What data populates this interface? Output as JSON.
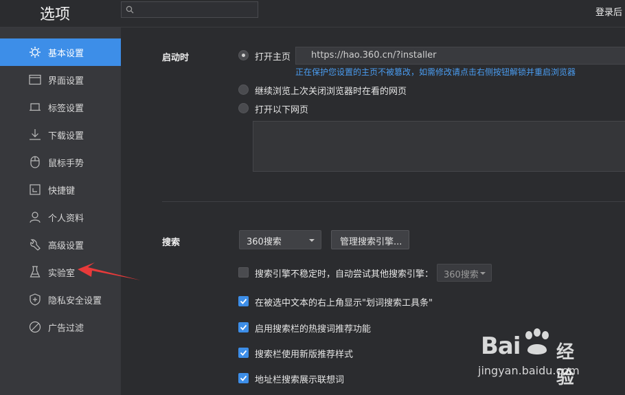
{
  "header": {
    "title": "选项",
    "search": {
      "value": "",
      "placeholder": ""
    },
    "login_label": "登录后"
  },
  "sidebar": {
    "items": [
      {
        "label": "基本设置",
        "icon": "gear-icon",
        "active": true
      },
      {
        "label": "界面设置",
        "icon": "window-icon",
        "active": false
      },
      {
        "label": "标签设置",
        "icon": "tab-icon",
        "active": false
      },
      {
        "label": "下载设置",
        "icon": "download-icon",
        "active": false
      },
      {
        "label": "鼠标手势",
        "icon": "mouse-icon",
        "active": false
      },
      {
        "label": "快捷键",
        "icon": "shortcut-icon",
        "active": false
      },
      {
        "label": "个人资料",
        "icon": "user-icon",
        "active": false
      },
      {
        "label": "高级设置",
        "icon": "wrench-icon",
        "active": false
      },
      {
        "label": "实验室",
        "icon": "flask-icon",
        "active": false
      },
      {
        "label": "隐私安全设置",
        "icon": "shield-icon",
        "active": false
      },
      {
        "label": "广告过滤",
        "icon": "block-icon",
        "active": false
      }
    ]
  },
  "startup": {
    "label": "启动时",
    "options": [
      {
        "label": "打开主页",
        "checked": true
      },
      {
        "label": "继续浏览上次关闭浏览器时在看的网页",
        "checked": false
      },
      {
        "label": "打开以下网页",
        "checked": false
      }
    ],
    "homepage_url": "https://hao.360.cn/?installer",
    "protect_hint": "正在保护您设置的主页不被篡改，如需修改请点击右侧按钮解锁并重启浏览器",
    "pages_list": ""
  },
  "search": {
    "label": "搜索",
    "engine_selected": "360搜索",
    "manage_button": "管理搜索引擎...",
    "options": [
      {
        "label": "搜索引擎不稳定时，自动尝试其他搜索引擎：",
        "checked": false
      },
      {
        "label": "在被选中文本的右上角显示\"划词搜索工具条\"",
        "checked": true
      },
      {
        "label": "启用搜索栏的热搜词推荐功能",
        "checked": true
      },
      {
        "label": "搜索栏使用新版推荐样式",
        "checked": true
      },
      {
        "label": "地址栏搜索展示联想词",
        "checked": true
      }
    ],
    "fallback_engine": "360搜索"
  },
  "annotation": {
    "arrow_color": "#e83a3a"
  },
  "watermark": {
    "logo_text": "Bai 经验",
    "url": "jingyan.baidu.com"
  },
  "colors": {
    "accent": "#3d8ee8",
    "link": "#4a9cf0",
    "background": "#2b2c2f",
    "sidebar": "#37383c"
  }
}
